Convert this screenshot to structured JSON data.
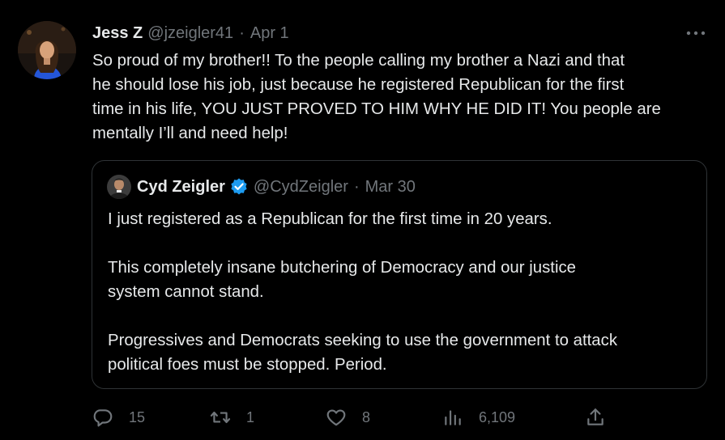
{
  "tweet": {
    "display_name": "Jess Z",
    "handle": "@jzeigler41",
    "separator": "·",
    "date": "Apr 1",
    "text": "So proud of my brother!! To the people calling my brother a Nazi and that\nhe should lose his job, just because he registered Republican for the first\ntime in his life, YOU JUST PROVED TO HIM WHY HE DID IT! You people are\nmentally I’ll and need help!"
  },
  "quoted": {
    "display_name": "Cyd Zeigler",
    "handle": "@CydZeigler",
    "separator": "·",
    "date": "Mar 30",
    "verified": true,
    "text": "I just registered as a Republican for the first time in 20 years.\n\nThis completely insane butchering of Democracy and our justice\nsystem cannot stand.\n\nProgressives and Democrats seeking to use the government to attack\npolitical foes must be stopped. Period."
  },
  "actions": {
    "reply_count": "15",
    "retweet_count": "1",
    "like_count": "8",
    "view_count": "6,109"
  },
  "icons": {
    "more": "more-icon",
    "verified": "verified-badge-icon",
    "reply": "reply-icon",
    "retweet": "retweet-icon",
    "like": "heart-icon",
    "views": "views-icon",
    "share": "share-icon"
  },
  "colors": {
    "background": "#000000",
    "text": "#e7e9ea",
    "muted": "#71767b",
    "border": "#2f3336",
    "verified": "#1d9bf0"
  }
}
